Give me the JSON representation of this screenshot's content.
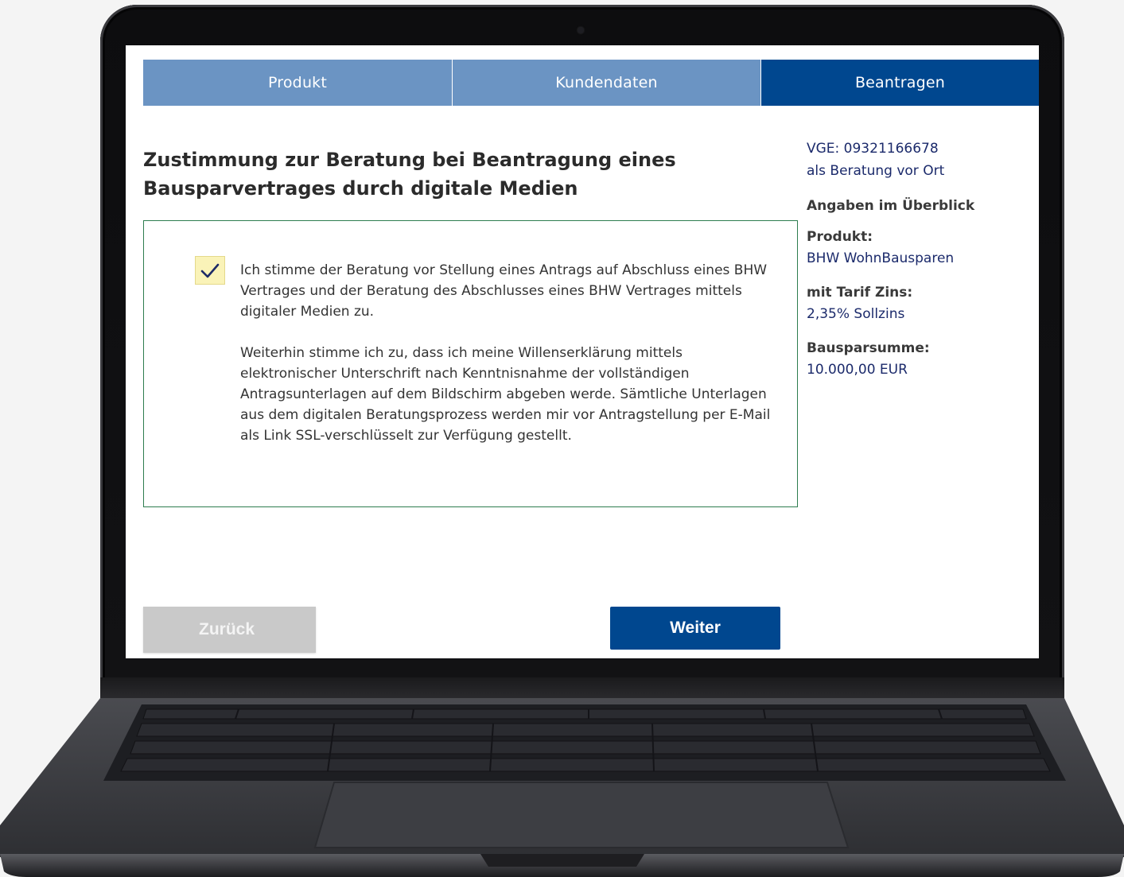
{
  "tabs": [
    {
      "label": "Produkt"
    },
    {
      "label": "Kundendaten"
    },
    {
      "label": "Beantragen"
    }
  ],
  "headline": "Zustimmung zur Beratung bei Beantragung eines Bausparvertrages durch digitale Medien",
  "consent": {
    "checked": true,
    "paragraph_1": "Ich stimme der Beratung vor Stellung eines Antrags auf Abschluss eines BHW Vertrages und der Beratung des Abschlusses eines BHW Vertrages mittels digitaler Medien zu.",
    "paragraph_2": "Weiterhin stimme ich zu, dass ich meine Willenserklärung mittels elektronischer Unterschrift nach Kenntnisnahme der vollständigen Antragsunterlagen auf dem Bildschirm abgeben werde. Sämtliche Unterlagen aus dem digitalen Beratungsprozess werden mir vor Antragstellung per E-Mail als Link SSL-verschlüsselt zur Verfügung gestellt."
  },
  "sidebar": {
    "vge": "VGE: 09321166678",
    "mode": "als Beratung vor Ort",
    "overview_heading": "Angaben im Überblick",
    "product_label": "Produkt:",
    "product_value": "BHW WohnBausparen",
    "tariff_label": "mit Tarif Zins:",
    "tariff_value": "2,35% Sollzins",
    "sum_label": "Bausparsumme:",
    "sum_value": "10.000,00 EUR"
  },
  "buttons": {
    "back": "Zurück",
    "next": "Weiter"
  },
  "colors": {
    "tab_inactive": "#6b94c3",
    "tab_active": "#00478f",
    "primary_button": "#00478f",
    "disabled_button": "#c9c9c9",
    "box_border": "#2e7d4f",
    "checkbox_fill": "#faf3b8"
  }
}
